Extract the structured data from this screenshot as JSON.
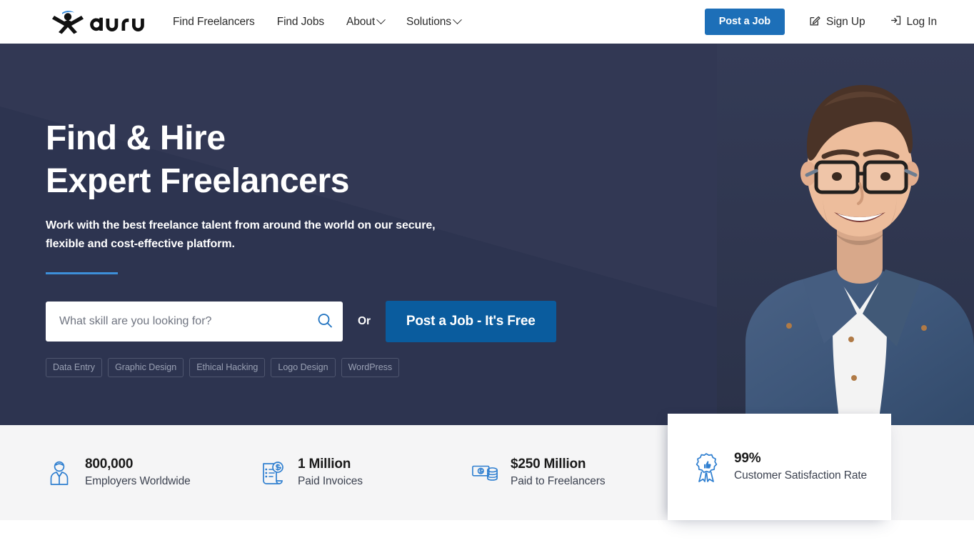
{
  "header": {
    "logo_text": "guru",
    "logo_icon": "guru-person-logo",
    "nav": [
      {
        "label": "Find Freelancers",
        "has_dropdown": false
      },
      {
        "label": "Find Jobs",
        "has_dropdown": false
      },
      {
        "label": "About",
        "has_dropdown": true
      },
      {
        "label": "Solutions",
        "has_dropdown": true
      }
    ],
    "post_job_label": "Post a Job",
    "sign_up_label": "Sign Up",
    "sign_up_icon": "pencil-edit-icon",
    "log_in_label": "Log In",
    "log_in_icon": "login-arrow-icon"
  },
  "hero": {
    "title_line1": "Find & Hire",
    "title_line2": "Expert Freelancers",
    "subtitle_line1": "Work with the best freelance talent from around the world on our secure,",
    "subtitle_line2": "flexible and cost-effective platform.",
    "search_placeholder": "What skill are you looking for?",
    "search_value": "",
    "search_icon": "search-icon",
    "or_label": "Or",
    "post_job_label": "Post a Job - It's Free",
    "tags": [
      "Data Entry",
      "Graphic Design",
      "Ethical Hacking",
      "Logo Design",
      "WordPress"
    ],
    "photo_alt": "smiling-man-with-glasses-in-denim-shirt"
  },
  "stats": [
    {
      "number": "800,000",
      "label": "Employers Worldwide",
      "icon": "employer-person-icon"
    },
    {
      "number": "1 Million",
      "label": "Paid Invoices",
      "icon": "invoice-dollar-icon"
    },
    {
      "number": "$250 Million",
      "label": "Paid to Freelancers",
      "icon": "cash-money-icon"
    },
    {
      "number": "99%",
      "label": "Customer Satisfaction Rate",
      "icon": "award-ribbon-thumbsup-icon"
    }
  ],
  "colors": {
    "hero_bg": "#2d3450",
    "hero_wedge": "#353c57",
    "accent_blue": "#3d8fd9",
    "header_button_blue": "#1d6fb8",
    "hero_button_blue": "#0a5c9e",
    "stats_bg": "#f5f5f6",
    "icon_blue": "#2f7fd0"
  }
}
